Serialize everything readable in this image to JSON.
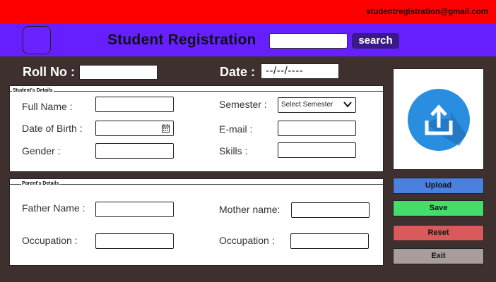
{
  "header": {
    "email": "studentregistration@gmail.com",
    "title": "Student Registration",
    "search_value": "",
    "search_label": "search"
  },
  "top_fields": {
    "roll_no_label": "Roll No :",
    "roll_no_value": "",
    "date_label": "Date :",
    "date_value": "--/--/----"
  },
  "student_details": {
    "legend": "Student's Details",
    "full_name_label": "Full Name :",
    "dob_label": "Date of Birth :",
    "gender_label": "Gender :",
    "semester_label": "Semester :",
    "semester_selected": "Select Semester",
    "email_label": "E-mail :",
    "skills_label": "Skills :"
  },
  "parent_details": {
    "legend": "Parent's Details",
    "father_name_label": "Father Name :",
    "mother_name_label": "Mother name:",
    "father_occupation_label": "Occupation :",
    "mother_occupation_label": "Occupation :"
  },
  "actions": {
    "upload": "Upload",
    "save": "Save",
    "reset": "Reset",
    "exit": "Exit"
  },
  "icons": {
    "upload_graphic": "upload-icon",
    "calendar": "calendar-icon",
    "dropdown": "chevron-down-icon"
  },
  "colors": {
    "top_bar": "#ff0000",
    "nav_bar": "#6620ff",
    "background": "#3d302e",
    "upload_button": "#4a80e0",
    "save_button": "#44dd6a",
    "reset_button": "#d85a5a",
    "exit_button": "#a89c9c",
    "upload_icon_circle": "#2a8ee0"
  }
}
